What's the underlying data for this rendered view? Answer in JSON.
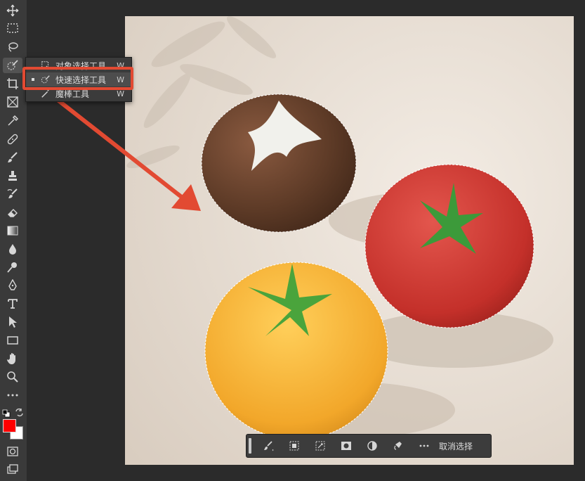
{
  "flyout": {
    "items": [
      {
        "label": "对象选择工具",
        "shortcut": "W"
      },
      {
        "label": "快速选择工具",
        "shortcut": "W"
      },
      {
        "label": "魔棒工具",
        "shortcut": "W"
      }
    ]
  },
  "context_bar": {
    "deselect_label": "取消选择"
  },
  "colors": {
    "foreground": "#ff0000",
    "background": "#ffffff",
    "annotation": "#e24a32"
  }
}
